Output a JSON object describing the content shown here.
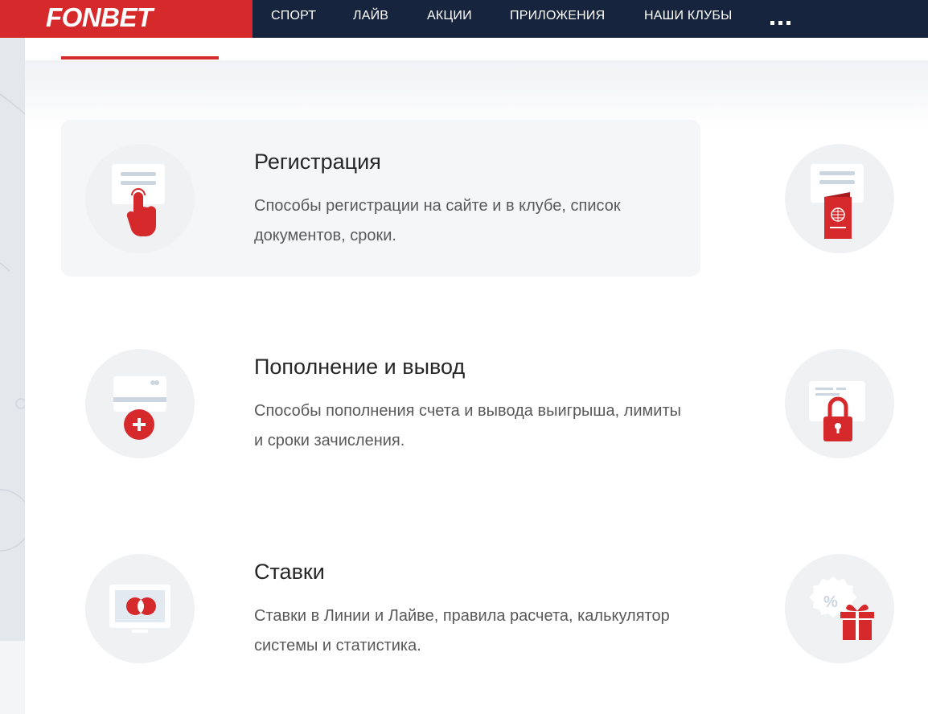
{
  "brand": {
    "logo": "FONBET",
    "red": "#d6292c",
    "navy": "#16253d"
  },
  "nav": {
    "items": [
      "СПОРТ",
      "ЛАЙВ",
      "АКЦИИ",
      "ПРИЛОЖЕНИЯ",
      "НАШИ КЛУБЫ"
    ],
    "more_icon": "ellipsis-icon"
  },
  "sections": [
    {
      "title": "Регистрация",
      "desc": "Способы регистрации на сайте и в клубе, список документов, сроки.",
      "icon": "registration-hand-icon"
    },
    {
      "title": "Пополнение и вывод",
      "desc": "Способы пополнения счета и вывода выигрыша, лимиты и сроки зачисления.",
      "icon": "card-plus-icon"
    },
    {
      "title": "Ставки",
      "desc": "Ставки в Линии и Лайве, правила расчета, калькулятор системы и статистика.",
      "icon": "monitor-icon"
    }
  ],
  "right_icons": [
    "passport-icon",
    "lock-card-icon",
    "promo-gift-icon"
  ]
}
